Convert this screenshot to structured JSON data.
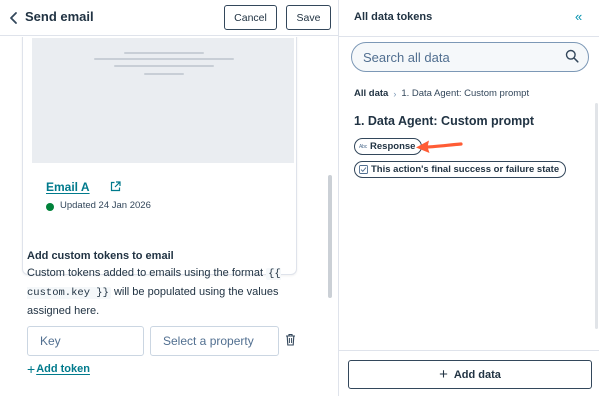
{
  "left_panel": {
    "title": "Send email",
    "cancel_label": "Cancel",
    "save_label": "Save",
    "email": {
      "name": "Email A",
      "updated": "Updated 24 Jan 2026",
      "status_color": "#00823a"
    },
    "custom_tokens": {
      "title": "Add custom tokens to email",
      "desc_part1": "Custom tokens added to emails using the format ",
      "desc_code": "{{ custom.key }}",
      "desc_part2": " will be populated using the values assigned here.",
      "key_placeholder": "Key",
      "property_placeholder": "Select a property",
      "add_token_label": "Add token"
    }
  },
  "right_panel": {
    "title": "All data tokens",
    "collapse_icon": "double-chevron-left-icon",
    "search_placeholder": "Search all data",
    "breadcrumb": {
      "root": "All data",
      "current": "1. Data Agent: Custom prompt"
    },
    "group_title": "1. Data Agent: Custom prompt",
    "tokens": [
      {
        "type_label": "Abc",
        "label": "Response",
        "icon": "text-type-icon"
      },
      {
        "label": "This action's final success or failure state",
        "icon": "checkbox-type-icon"
      }
    ],
    "add_data_label": "Add data"
  },
  "colors": {
    "accent": "#007a8c",
    "link": "#0091ae",
    "arrow": "#ff5c35",
    "text_dark": "#213343"
  }
}
